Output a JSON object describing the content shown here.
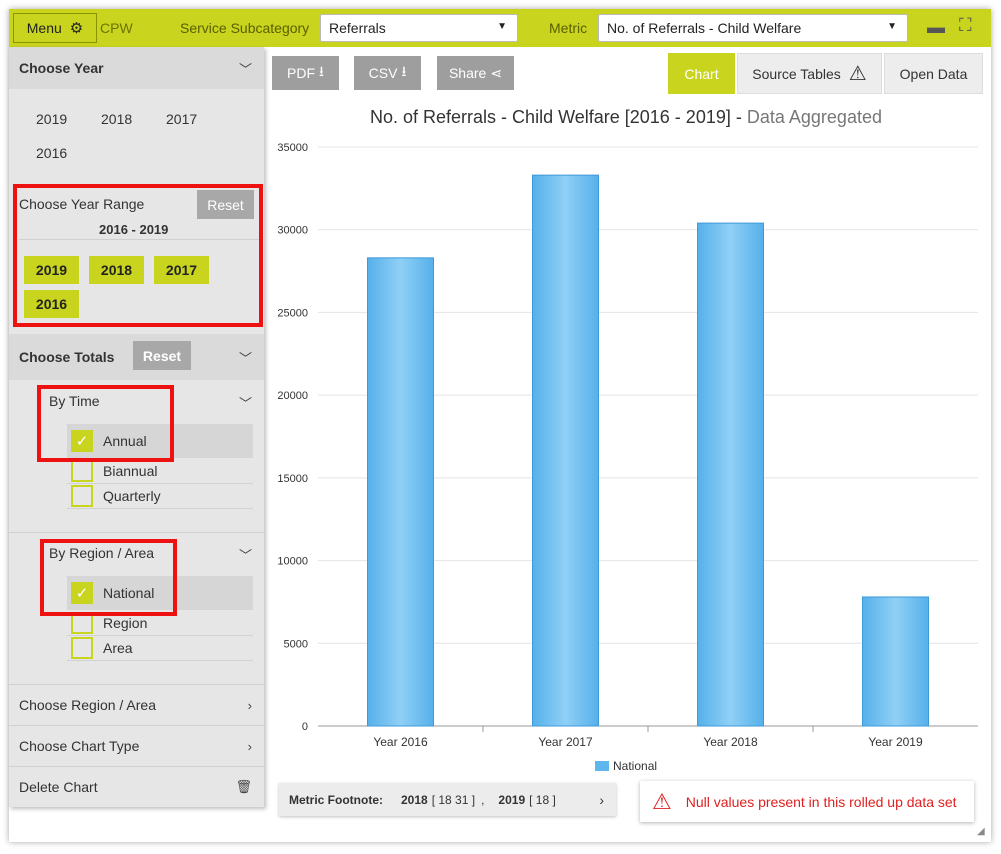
{
  "topbar": {
    "menu_label": "Menu",
    "app_code": "CPW",
    "subcategory_label": "Service Subcategory",
    "subcategory_value": "Referrals",
    "metric_label": "Metric",
    "metric_value": "No. of Referrals - Child Welfare"
  },
  "sidebar": {
    "choose_year": {
      "title": "Choose Year",
      "years": [
        "2019",
        "2018",
        "2017",
        "2016"
      ]
    },
    "year_range": {
      "label": "Choose Year Range",
      "reset": "Reset",
      "range": "2016 - 2019",
      "chips": [
        "2019",
        "2018",
        "2017",
        "2016"
      ]
    },
    "totals": {
      "title": "Choose Totals",
      "reset": "Reset",
      "by_time": {
        "label": "By Time",
        "options": [
          "Annual",
          "Biannual",
          "Quarterly"
        ],
        "checked": "Annual"
      },
      "by_region": {
        "label": "By Region / Area",
        "options": [
          "National",
          "Region",
          "Area"
        ],
        "checked": "National"
      }
    },
    "links": {
      "region": "Choose Region / Area",
      "chart_type": "Choose Chart Type",
      "delete": "Delete Chart"
    }
  },
  "toolbar": {
    "pdf": "PDF",
    "csv": "CSV",
    "share": "Share",
    "tabs": [
      "Chart",
      "Source Tables",
      "Open Data"
    ],
    "active_tab": "Chart"
  },
  "chart_title": {
    "main": "No. of Referrals - Child Welfare [2016 - 2019] -",
    "suffix": "Data Aggregated"
  },
  "chart_data": {
    "type": "bar",
    "categories": [
      "Year 2016",
      "Year 2017",
      "Year 2018",
      "Year 2019"
    ],
    "series": [
      {
        "name": "National",
        "values": [
          28300,
          33300,
          30400,
          7800
        ],
        "color": "#5fb6ec"
      }
    ],
    "ylim": [
      0,
      35000
    ],
    "yticks": [
      0,
      5000,
      10000,
      15000,
      20000,
      25000,
      30000,
      35000
    ],
    "grid": true,
    "legend": "bottom-center"
  },
  "footnote": {
    "label": "Metric Footnote:",
    "items": [
      {
        "year": "2018",
        "notes": "[ 18  31 ]"
      },
      {
        "year": "2019",
        "notes": "[ 18 ]"
      }
    ],
    "separator": ","
  },
  "warning": {
    "text": "Null values present in this rolled up data set"
  },
  "colors": {
    "accent": "#c8d41e",
    "highlight": "#ee1111",
    "bar": "#5fb6ec",
    "warning": "#e02020"
  }
}
